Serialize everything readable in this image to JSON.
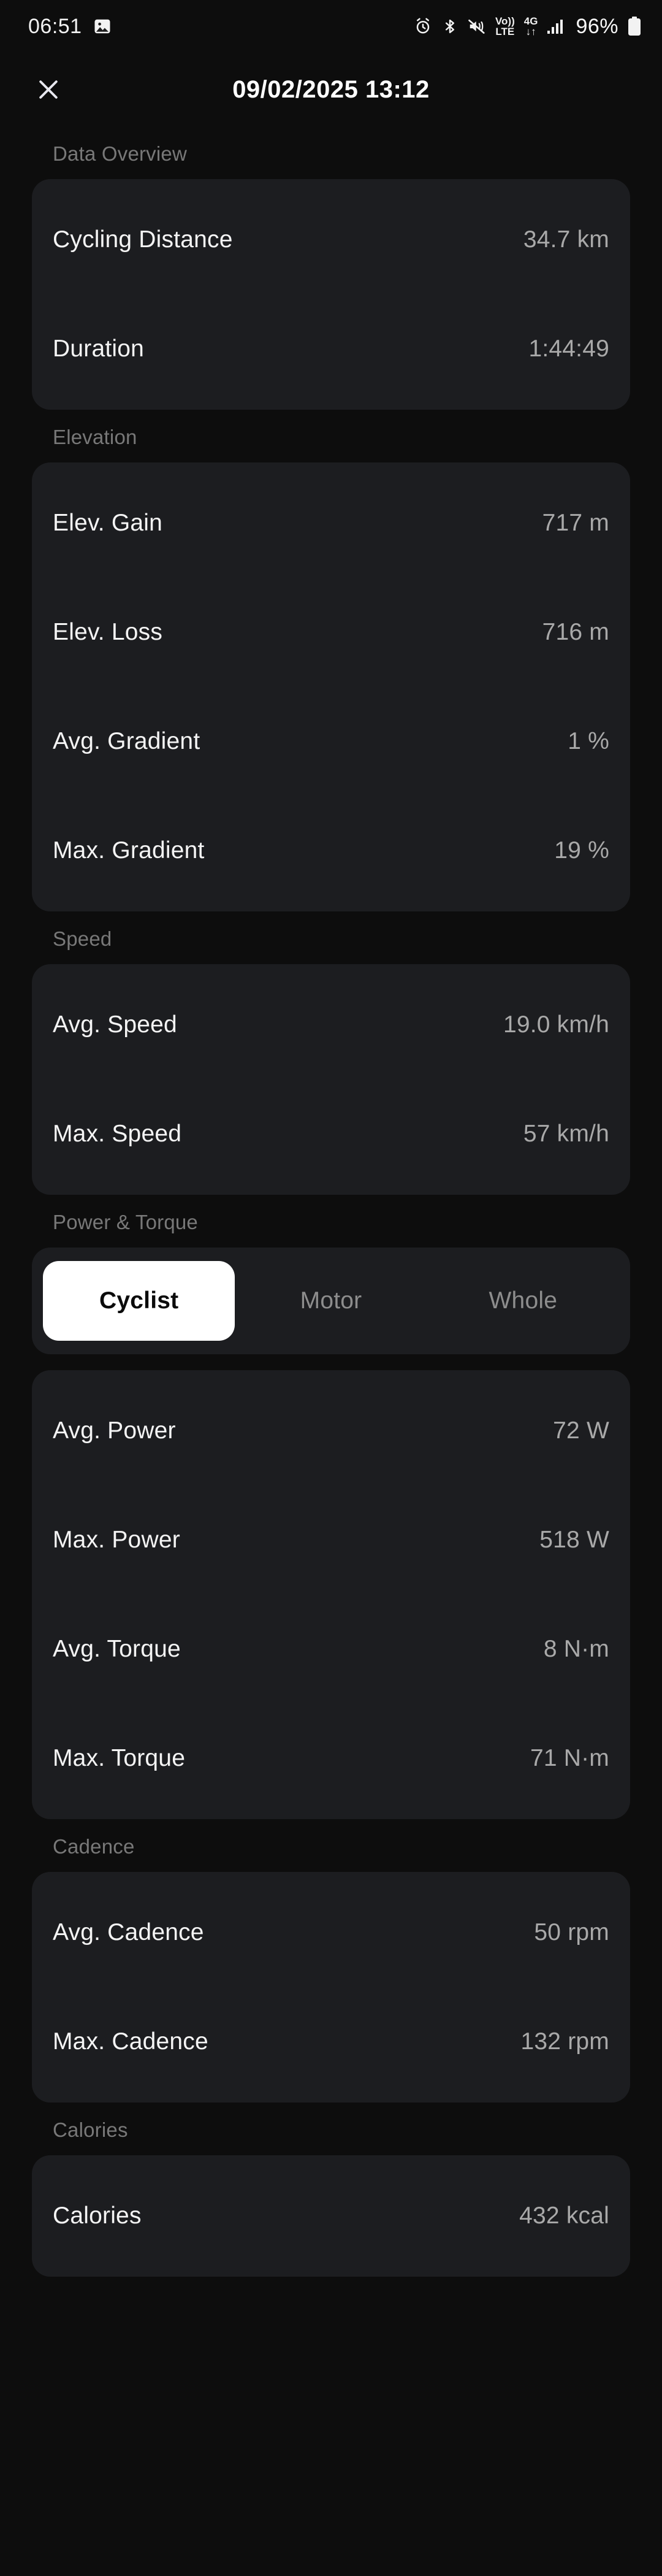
{
  "status_bar": {
    "clock": "06:51",
    "battery_percent": "96%",
    "volte_top": "Vo))",
    "volte_bottom": "LTE",
    "network_top": "4G",
    "network_bottom": "↓↑",
    "icons": [
      "screenshot-icon",
      "alarm-icon",
      "bluetooth-icon",
      "mute-icon",
      "volte-icon",
      "network-4g-icon",
      "signal-icon",
      "battery-icon"
    ]
  },
  "header": {
    "title": "09/02/2025 13:12",
    "close_label": "✕"
  },
  "sections": {
    "data_overview": {
      "title": "Data Overview",
      "rows": [
        {
          "label": "Cycling Distance",
          "value": "34.7 km"
        },
        {
          "label": "Duration",
          "value": "1:44:49"
        }
      ]
    },
    "elevation": {
      "title": "Elevation",
      "rows": [
        {
          "label": "Elev. Gain",
          "value": "717 m"
        },
        {
          "label": "Elev. Loss",
          "value": "716 m"
        },
        {
          "label": "Avg. Gradient",
          "value": "1 %"
        },
        {
          "label": "Max. Gradient",
          "value": "19 %"
        }
      ]
    },
    "speed": {
      "title": "Speed",
      "rows": [
        {
          "label": "Avg. Speed",
          "value": "19.0 km/h"
        },
        {
          "label": "Max. Speed",
          "value": "57 km/h"
        }
      ]
    },
    "power_torque": {
      "title": "Power & Torque",
      "tabs": [
        {
          "label": "Cyclist",
          "active": true
        },
        {
          "label": "Motor",
          "active": false
        },
        {
          "label": "Whole",
          "active": false
        }
      ],
      "rows": [
        {
          "label": "Avg. Power",
          "value": "72 W"
        },
        {
          "label": "Max. Power",
          "value": "518 W"
        },
        {
          "label": "Avg. Torque",
          "value": "8 N·m"
        },
        {
          "label": "Max. Torque",
          "value": "71 N·m"
        }
      ]
    },
    "cadence": {
      "title": "Cadence",
      "rows": [
        {
          "label": "Avg. Cadence",
          "value": "50 rpm"
        },
        {
          "label": "Max. Cadence",
          "value": "132 rpm"
        }
      ]
    },
    "calories": {
      "title": "Calories",
      "rows": [
        {
          "label": "Calories",
          "value": "432 kcal"
        }
      ]
    }
  },
  "colors": {
    "page_background": "#0d0d0d",
    "card_background": "#1c1d20",
    "label_text": "#f4f4f4",
    "value_text": "#a9a9a9",
    "section_title": "#787878",
    "active_tab_background": "#ffffff",
    "active_tab_text": "#0b0b0b",
    "inactive_tab_text": "#8d8d8d"
  }
}
